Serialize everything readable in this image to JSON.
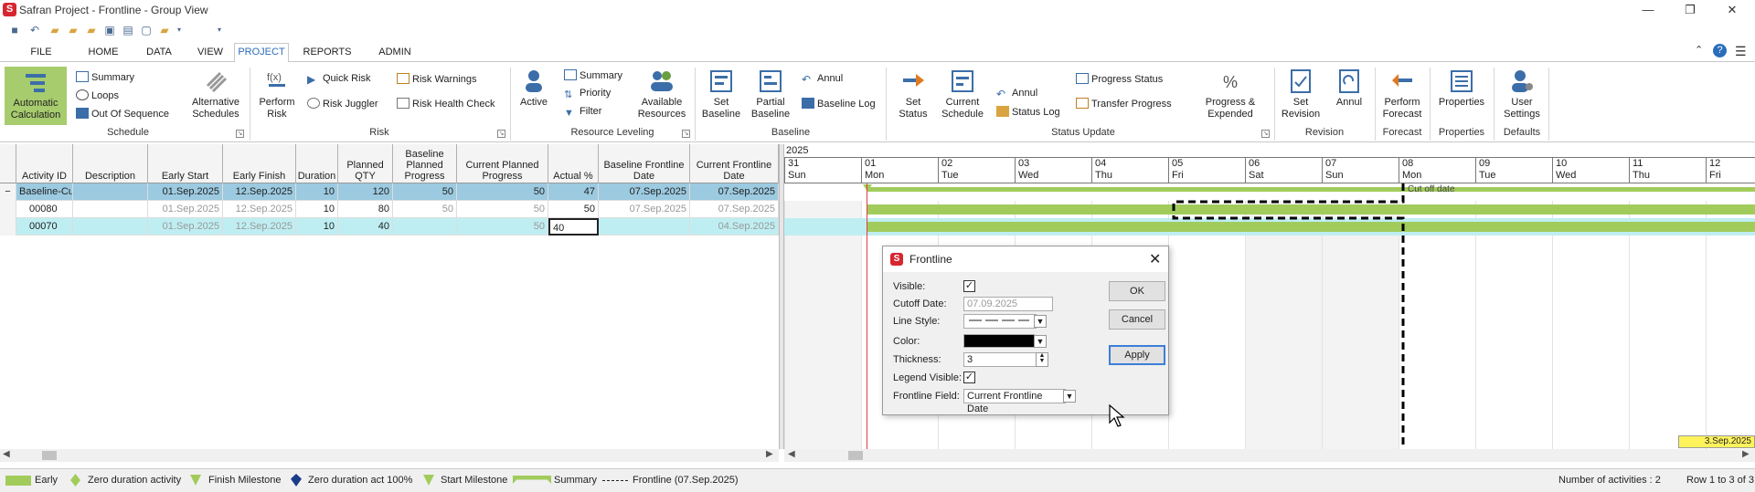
{
  "window": {
    "title": "Safran Project - Frontline - Group View",
    "min": "—",
    "restore": "❐",
    "close": "✕"
  },
  "tabs": [
    "FILE",
    "HOME",
    "DATA",
    "VIEW",
    "PROJECT",
    "REPORTS",
    "ADMIN"
  ],
  "active_tab": "PROJECT",
  "ribbon": {
    "schedule": {
      "group": "Schedule",
      "auto_calc": "Automatic\nCalculation",
      "summary": "Summary",
      "loops": "Loops",
      "out_of_sequence": "Out Of Sequence",
      "alt_schedules": "Alternative\nSchedules"
    },
    "risk": {
      "group": "Risk",
      "perform_risk": "Perform\nRisk",
      "quick_risk": "Quick Risk",
      "risk_juggler": "Risk Juggler",
      "risk_warnings": "Risk Warnings",
      "risk_health": "Risk Health Check"
    },
    "resource": {
      "group": "Resource Leveling",
      "active": "Active",
      "summary": "Summary",
      "priority": "Priority",
      "filter": "Filter",
      "available": "Available\nResources"
    },
    "baseline": {
      "group": "Baseline",
      "set_baseline": "Set\nBaseline",
      "partial_baseline": "Partial\nBaseline",
      "annul": "Annul",
      "baseline_log": "Baseline Log"
    },
    "status": {
      "group": "Status Update",
      "set_status": "Set\nStatus",
      "current_schedule": "Current\nSchedule",
      "annul": "Annul",
      "status_log": "Status Log",
      "progress_status": "Progress Status",
      "transfer_progress": "Transfer Progress",
      "progress_expended": "Progress &\nExpended"
    },
    "revision": {
      "group": "Revision",
      "set_revision": "Set\nRevision",
      "annul": "Annul"
    },
    "forecast": {
      "group": "Forecast",
      "perform_forecast": "Perform\nForecast"
    },
    "properties": {
      "group": "Properties",
      "properties": "Properties"
    },
    "defaults": {
      "group": "Defaults",
      "user_settings": "User\nSettings"
    }
  },
  "grid": {
    "columns": [
      "Activity ID",
      "Description",
      "Early Start",
      "Early Finish",
      "Duration",
      "Planned\nQTY",
      "Baseline\nPlanned\nProgress",
      "Current Planned\nProgress",
      "Actual %",
      "Baseline Frontline\nDate",
      "Current Frontline\nDate"
    ],
    "rows": [
      {
        "id": "Baseline-Cur",
        "desc": "",
        "es": "01.Sep.2025",
        "ef": "12.Sep.2025",
        "dur": "10",
        "qty": "120",
        "bpp": "50",
        "cpp": "50",
        "act": "47",
        "bfd": "07.Sep.2025",
        "cfd": "07.Sep.2025"
      },
      {
        "id": "00080",
        "desc": "",
        "es": "01.Sep.2025",
        "ef": "12.Sep.2025",
        "dur": "10",
        "qty": "80",
        "bpp": "50",
        "cpp": "50",
        "act": "50",
        "bfd": "07.Sep.2025",
        "cfd": "07.Sep.2025"
      },
      {
        "id": "00070",
        "desc": "",
        "es": "01.Sep.2025",
        "ef": "12.Sep.2025",
        "dur": "10",
        "qty": "40",
        "bpp": "",
        "cpp": "50",
        "act": "40",
        "bfd": "",
        "cfd": "04.Sep.2025"
      }
    ],
    "collapse_glyph": "−"
  },
  "gantt": {
    "year": "2025",
    "days": [
      {
        "num": "31",
        "dow": "Sun"
      },
      {
        "num": "01",
        "dow": "Mon"
      },
      {
        "num": "02",
        "dow": "Tue"
      },
      {
        "num": "03",
        "dow": "Wed"
      },
      {
        "num": "04",
        "dow": "Thu"
      },
      {
        "num": "05",
        "dow": "Fri"
      },
      {
        "num": "06",
        "dow": "Sat"
      },
      {
        "num": "07",
        "dow": "Sun"
      },
      {
        "num": "08",
        "dow": "Mon"
      },
      {
        "num": "09",
        "dow": "Tue"
      },
      {
        "num": "10",
        "dow": "Wed"
      },
      {
        "num": "11",
        "dow": "Thu"
      },
      {
        "num": "12",
        "dow": "Fri"
      }
    ],
    "cutoff_label": "Cut off date",
    "date_badge": "3.Sep.2025"
  },
  "dialog": {
    "title": "Frontline",
    "visible_label": "Visible:",
    "cutoff_label": "Cutoff Date:",
    "cutoff_value": "07.09.2025",
    "line_style_label": "Line Style:",
    "color_label": "Color:",
    "color_value": "#000000",
    "thickness_label": "Thickness:",
    "thickness_value": "3",
    "legend_visible_label": "Legend Visible:",
    "frontline_field_label": "Frontline Field:",
    "frontline_field_value": "Current Frontline Date",
    "ok": "OK",
    "cancel": "Cancel",
    "apply": "Apply",
    "check": "✓"
  },
  "legend": {
    "items": [
      "Early",
      "Zero duration activity",
      "Finish Milestone",
      "Zero duration act 100%",
      "Start Milestone",
      "Summary",
      "Frontline (07.Sep.2025)"
    ],
    "activity_count": "Number of activities : 2",
    "row_pos": "Row 1 to 3 of 3"
  },
  "colors": {
    "accent": "#2a6ebb",
    "bar": "#a1cc5c",
    "selected_row": "#bfeef2",
    "summary_row": "#9ccae0",
    "brand": "#d7262f"
  }
}
